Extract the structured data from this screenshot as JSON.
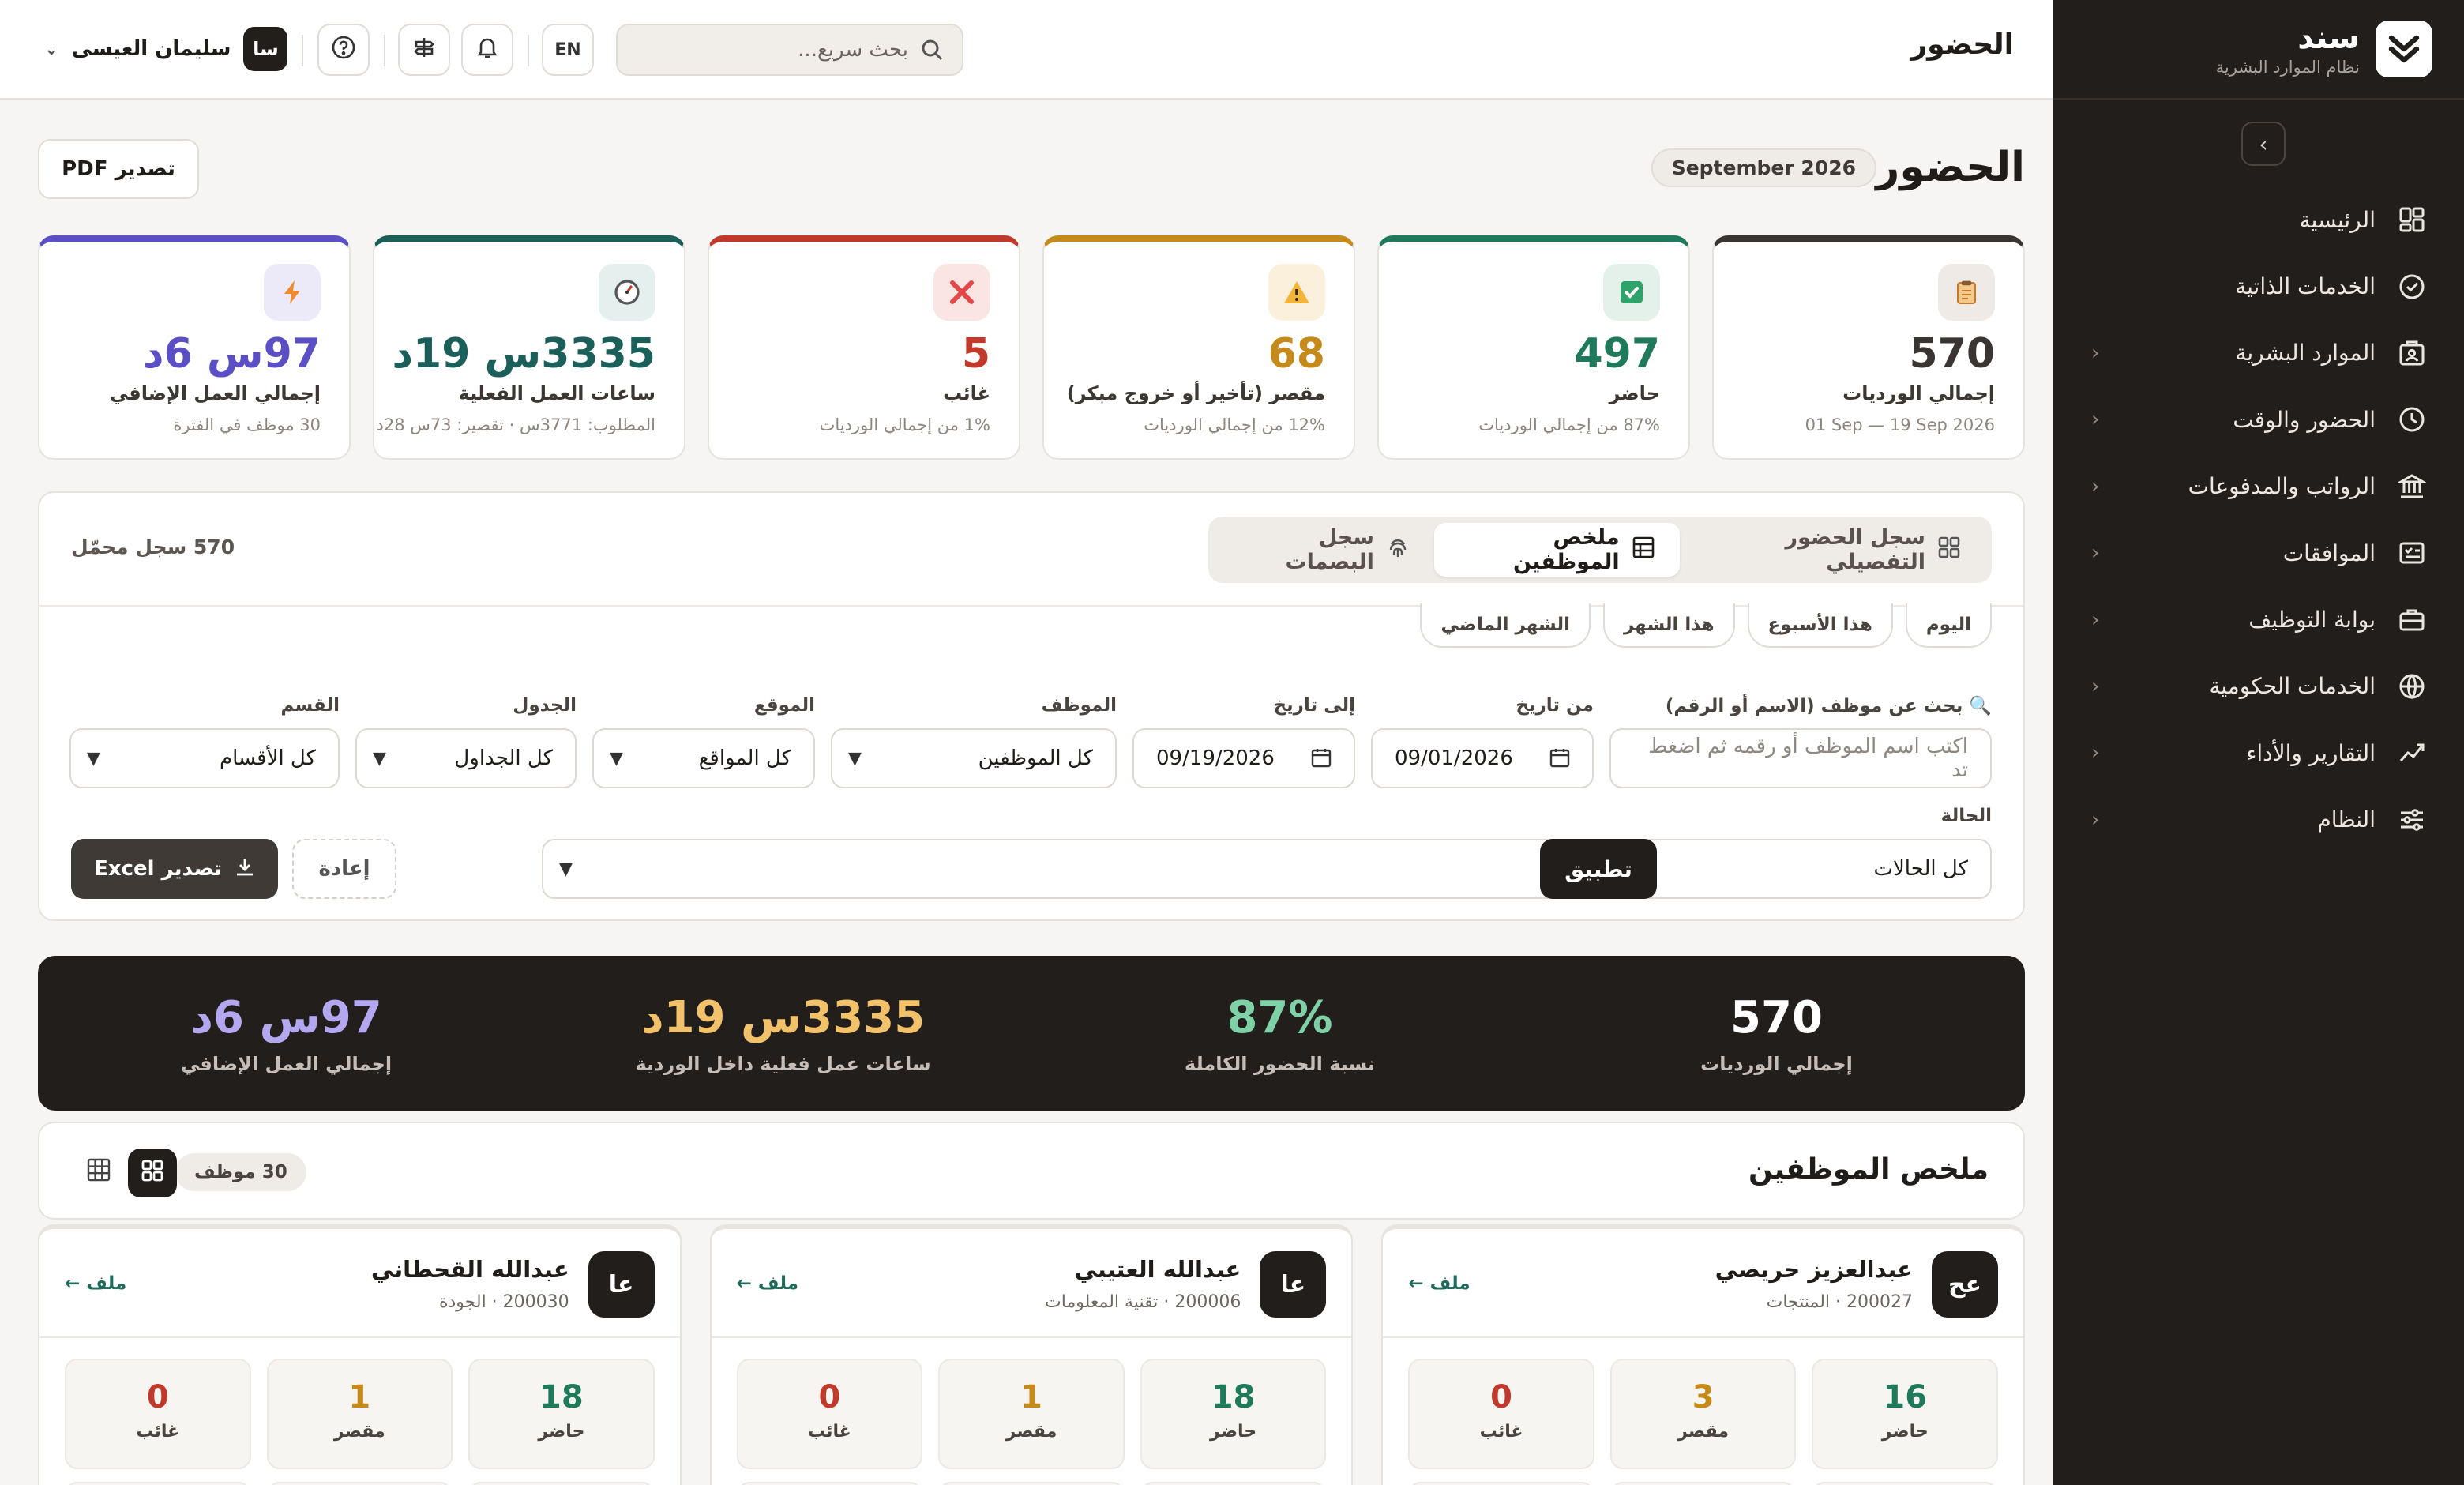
{
  "brand": {
    "name": "سند",
    "subtitle": "نظام الموارد البشرية"
  },
  "sidebar": {
    "items": [
      {
        "label": "الرئيسية",
        "icon": "dashboard-icon",
        "chevron": false
      },
      {
        "label": "الخدمات الذاتية",
        "icon": "self-service-icon",
        "chevron": false
      },
      {
        "label": "الموارد البشرية",
        "icon": "hr-icon",
        "chevron": true
      },
      {
        "label": "الحضور والوقت",
        "icon": "clock-icon",
        "chevron": true
      },
      {
        "label": "الرواتب والمدفوعات",
        "icon": "bank-icon",
        "chevron": true
      },
      {
        "label": "الموافقات",
        "icon": "approvals-icon",
        "chevron": true
      },
      {
        "label": "بوابة التوظيف",
        "icon": "briefcase-icon",
        "chevron": true
      },
      {
        "label": "الخدمات الحكومية",
        "icon": "globe-icon",
        "chevron": true
      },
      {
        "label": "التقارير والأداء",
        "icon": "chart-icon",
        "chevron": true
      },
      {
        "label": "النظام",
        "icon": "sliders-icon",
        "chevron": true
      }
    ]
  },
  "topbar": {
    "title": "الحضور",
    "search_placeholder": "بحث سريع...",
    "lang": "EN",
    "user_name": "سليمان العيسى",
    "user_initials": "سا"
  },
  "page": {
    "title": "الحضور",
    "month": "September 2026",
    "export_pdf": "تصدير PDF"
  },
  "kpis": [
    {
      "value": "570",
      "label": "إجمالي الورديات",
      "sub": "01 Sep — 19 Sep 2026",
      "color": "#3a3533",
      "icon_bg": "#efeae5",
      "icon": "clipboard-icon"
    },
    {
      "value": "497",
      "label": "حاضر",
      "sub": "87% من إجمالي الورديات",
      "color": "#1f7a5c",
      "icon_bg": "#e3f1ea",
      "icon": "check-icon"
    },
    {
      "value": "68",
      "label": "مقصر (تأخير أو خروج مبكر)",
      "sub": "12% من إجمالي الورديات",
      "color": "#c68a1a",
      "icon_bg": "#fbf0dc",
      "icon": "warning-icon"
    },
    {
      "value": "5",
      "label": "غائب",
      "sub": "1% من إجمالي الورديات",
      "color": "#c0392b",
      "icon_bg": "#fbe5e3",
      "icon": "x-icon"
    },
    {
      "value": "3335س 19د",
      "label": "ساعات العمل الفعلية",
      "sub": "المطلوب: 3771س · تقصير: 73س 28د",
      "color": "#1b5f5a",
      "icon_bg": "#e4efee",
      "icon": "timer-icon"
    },
    {
      "value": "97س 6د",
      "label": "إجمالي العمل الإضافي",
      "sub": "30 موظف في الفترة",
      "color": "#5a4fc4",
      "icon_bg": "#ece9f8",
      "icon": "bolt-icon"
    }
  ],
  "tabs": [
    {
      "label": "سجل الحضور التفصيلي",
      "icon": "grid-icon",
      "active": false
    },
    {
      "label": "ملخص الموظفين",
      "icon": "table-icon",
      "active": true
    },
    {
      "label": "سجل البصمات",
      "icon": "fingerprint-icon",
      "active": false
    }
  ],
  "record_count": "570 سجل محمّل",
  "quick_filters": [
    "اليوم",
    "هذا الأسبوع",
    "هذا الشهر",
    "الشهر الماضي"
  ],
  "filters": {
    "search_label": "بحث عن موظف (الاسم أو الرقم)",
    "search_placeholder": "اكتب اسم الموظف أو رقمه ثم اضغط تد",
    "from_label": "من تاريخ",
    "from_value": "09/01/2026",
    "to_label": "إلى تاريخ",
    "to_value": "09/19/2026",
    "employee_label": "الموظف",
    "employee_value": "كل الموظفين",
    "location_label": "الموقع",
    "location_value": "كل المواقع",
    "schedule_label": "الجدول",
    "schedule_value": "كل الجداول",
    "department_label": "القسم",
    "department_value": "كل الأقسام",
    "status_label": "الحالة",
    "status_value": "كل الحالات",
    "apply": "تطبيق",
    "reset": "إعادة",
    "export_excel": "تصدير Excel"
  },
  "summary": [
    {
      "value": "570",
      "label": "إجمالي الورديات",
      "color": "#ffffff"
    },
    {
      "value": "87%",
      "label": "نسبة الحضور الكاملة",
      "color": "#7fd1a8"
    },
    {
      "value": "3335س 19د",
      "label": "ساعات عمل فعلية داخل الوردية",
      "color": "#f2c26b"
    },
    {
      "value": "97س 6د",
      "label": "إجمالي العمل الإضافي",
      "color": "#b3a8f0"
    }
  ],
  "employees_section": {
    "title": "ملخص الموظفين",
    "count": "30 موظف"
  },
  "employees": [
    {
      "initials": "عح",
      "name": "عبدالعزيز حريصي",
      "meta": "200027 · المنتجات",
      "link": "ملف ←",
      "present": "16",
      "late": "3",
      "absent": "0"
    },
    {
      "initials": "عا",
      "name": "عبدالله العتيبي",
      "meta": "200006 · تقنية المعلومات",
      "link": "ملف ←",
      "present": "18",
      "late": "1",
      "absent": "0"
    },
    {
      "initials": "عا",
      "name": "عبدالله القحطاني",
      "meta": "200030 · الجودة",
      "link": "ملف ←",
      "present": "18",
      "late": "1",
      "absent": "0"
    }
  ],
  "labels": {
    "present": "حاضر",
    "late": "مقصر",
    "absent": "غائب"
  },
  "colors": {
    "present": "#1f7a5c",
    "late": "#c68a1a",
    "absent": "#c0392b"
  }
}
